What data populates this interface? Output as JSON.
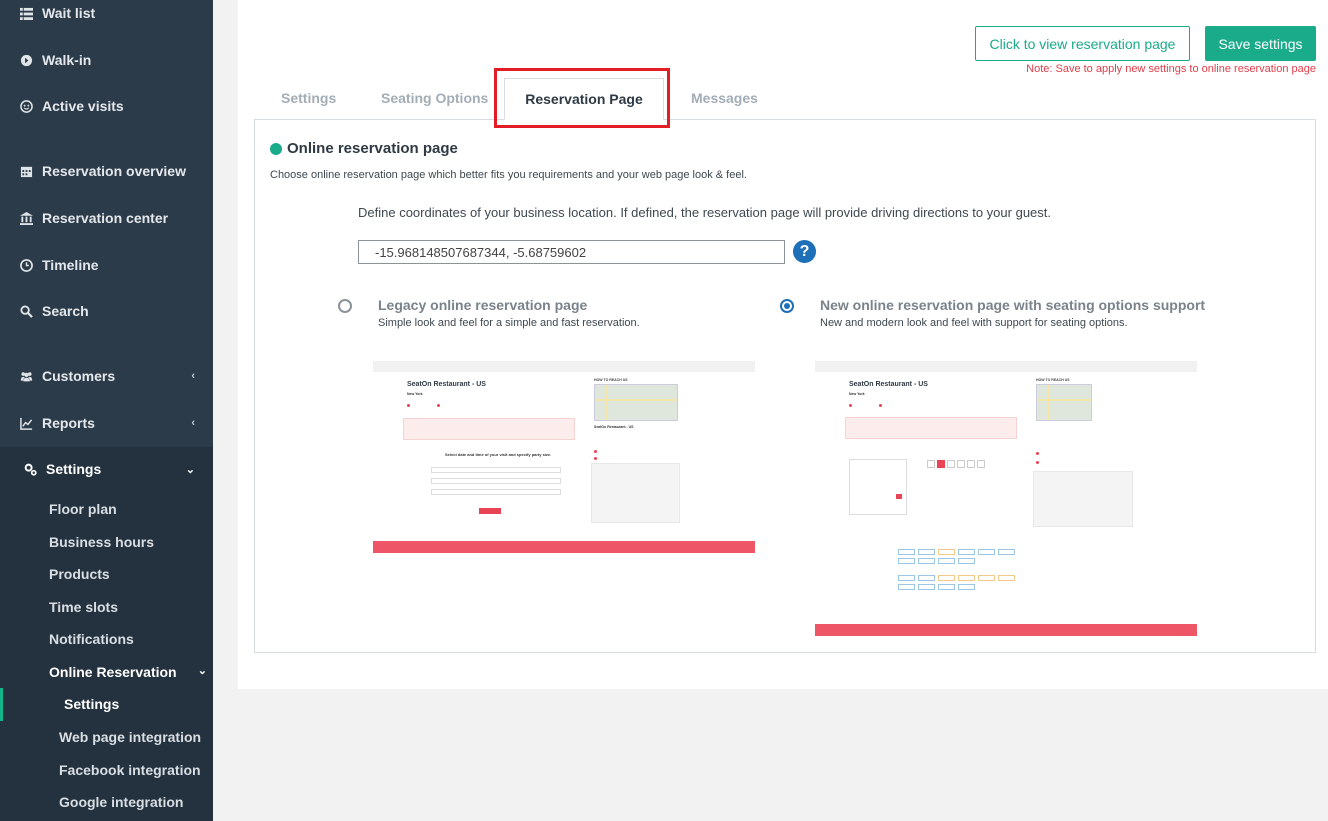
{
  "sidebar": {
    "items": [
      {
        "label": "Wait list",
        "icon": "list-icon"
      },
      {
        "label": "Walk-in",
        "icon": "circle-arrow-icon"
      },
      {
        "label": "Active visits",
        "icon": "smiley-icon"
      },
      {
        "label": "Reservation overview",
        "icon": "calendar-icon"
      },
      {
        "label": "Reservation center",
        "icon": "building-icon"
      },
      {
        "label": "Timeline",
        "icon": "clock-icon"
      },
      {
        "label": "Search",
        "icon": "search-icon"
      },
      {
        "label": "Customers",
        "icon": "users-icon"
      },
      {
        "label": "Reports",
        "icon": "chart-icon"
      },
      {
        "label": "Settings",
        "icon": "gears-icon"
      }
    ],
    "settings_sub": [
      "Floor plan",
      "Business hours",
      "Products",
      "Time slots",
      "Notifications",
      "Online Reservation"
    ],
    "online_sub": [
      "Settings",
      "Web page integration",
      "Facebook integration",
      "Google integration"
    ]
  },
  "header": {
    "view_button": "Click to view reservation page",
    "save_button": "Save settings",
    "save_note": "Note: Save to apply new settings to online reservation page"
  },
  "tabs": [
    "Settings",
    "Seating Options",
    "Reservation Page",
    "Messages"
  ],
  "active_tab": "Reservation Page",
  "panel": {
    "title": "Online reservation page",
    "description": "Choose online reservation page which better fits you requirements and your web page look & feel.",
    "coord_label": "Define coordinates of your business location. If defined, the reservation page will provide driving directions to your guest.",
    "coord_value": "-15.968148507687344, -5.68759602",
    "help": "?"
  },
  "options": [
    {
      "title": "Legacy online reservation page",
      "desc": "Simple look and feel for a simple and fast reservation.",
      "selected": false
    },
    {
      "title": "New online reservation page with seating options support",
      "desc": "New and modern look and feel with support for seating options.",
      "selected": true
    }
  ],
  "preview": {
    "restaurant": "SeatOn Restaurant - US",
    "city": "New York",
    "how_to_reach": "HOW TO REACH US",
    "legacy_prompt": "Select date and time of your visit and specify party size.",
    "book_label": "Book a table"
  },
  "colors": {
    "accent": "#1aab8a",
    "sidebar": "#2c3b49",
    "highlight": "#e31d25",
    "radio": "#1d6fb8"
  }
}
